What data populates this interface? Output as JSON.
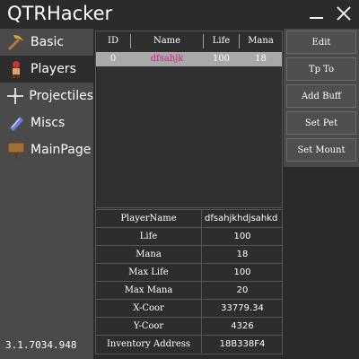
{
  "window": {
    "title": "QTRHacker"
  },
  "sidebar": {
    "items": [
      {
        "label": "Basic",
        "icon": "pickaxe-icon"
      },
      {
        "label": "Players",
        "icon": "player-icon"
      },
      {
        "label": "Projectiles",
        "icon": "crosshair-icon"
      },
      {
        "label": "Miscs",
        "icon": "scroll-icon"
      },
      {
        "label": "MainPage",
        "icon": "sign-icon"
      }
    ],
    "active": "Players",
    "version": "3.1.7034.948"
  },
  "players_table": {
    "columns": [
      "ID",
      "Name",
      "Life",
      "Mana"
    ],
    "rows": [
      {
        "id": "0",
        "name": "dfsahjk",
        "life": "100",
        "mana": "18"
      }
    ],
    "selected_row": 0
  },
  "actions": [
    "Edit",
    "Tp To",
    "Add Buff",
    "Set Pet",
    "Set Mount"
  ],
  "details": [
    {
      "label": "PlayerName",
      "value": "dfsahjkhdjsahkd"
    },
    {
      "label": "Life",
      "value": "100"
    },
    {
      "label": "Mana",
      "value": "18"
    },
    {
      "label": "Max Life",
      "value": "100"
    },
    {
      "label": "Max Mana",
      "value": "20"
    },
    {
      "label": "X-Coor",
      "value": "33779.34"
    },
    {
      "label": "Y-Coor",
      "value": "4326"
    },
    {
      "label": "Inventory Address",
      "value": "18B338F4"
    }
  ],
  "colors": {
    "background": "#2b2b2b",
    "sidebar": "#4a4a4a",
    "selected_row": "#a9a9a9",
    "player_name": "#d81e7e"
  }
}
